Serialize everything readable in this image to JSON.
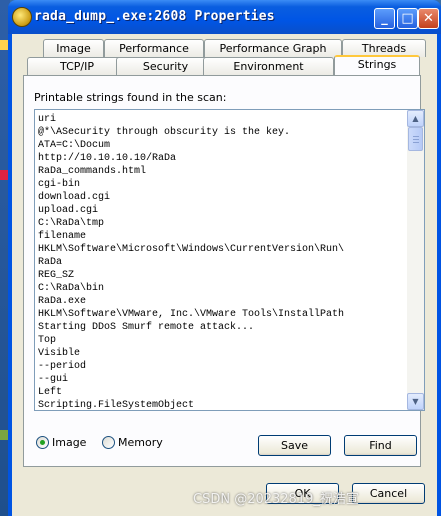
{
  "window": {
    "title": "rada_dump_.exe:2608 Properties",
    "minimize_glyph": "_",
    "maximize_glyph": "□",
    "close_glyph": "✕",
    "app_icon": "process-icon"
  },
  "tabs_row1": [
    "Image",
    "Performance",
    "Performance Graph",
    "Threads"
  ],
  "tabs_row2": [
    "TCP/IP",
    "Security",
    "Environment",
    "Strings"
  ],
  "active_tab": "Strings",
  "strings_panel": {
    "caption": "Printable strings found in the scan:",
    "lines": [
      "uri",
      "@*\\ASecurity through obscurity is the key.",
      "ATA=C:\\Docum",
      "http://10.10.10.10/RaDa",
      "RaDa_commands.html",
      "cgi-bin",
      "download.cgi",
      "upload.cgi",
      "C:\\RaDa\\tmp",
      "filename",
      "HKLM\\Software\\Microsoft\\Windows\\CurrentVersion\\Run\\",
      "RaDa",
      "REG_SZ",
      "C:\\RaDa\\bin",
      "RaDa.exe",
      "HKLM\\Software\\VMware, Inc.\\VMware Tools\\InstallPath",
      "Starting DDoS Smurf remote attack...",
      "Top",
      "Visible",
      "--period",
      "--gui",
      "Left",
      "Scripting.FileSystemObject"
    ]
  },
  "scan_source": {
    "options": [
      "Image",
      "Memory"
    ],
    "selected": "Image"
  },
  "buttons": {
    "save": "Save",
    "find": "Find",
    "ok": "OK",
    "cancel": "Cancel"
  },
  "watermark": "CSDN @20232819_祝浩宣",
  "colors": {
    "titlebar": "#0055e5",
    "dialog_bg": "#ece9d8",
    "active_tab_accent": "#ffc83c"
  }
}
